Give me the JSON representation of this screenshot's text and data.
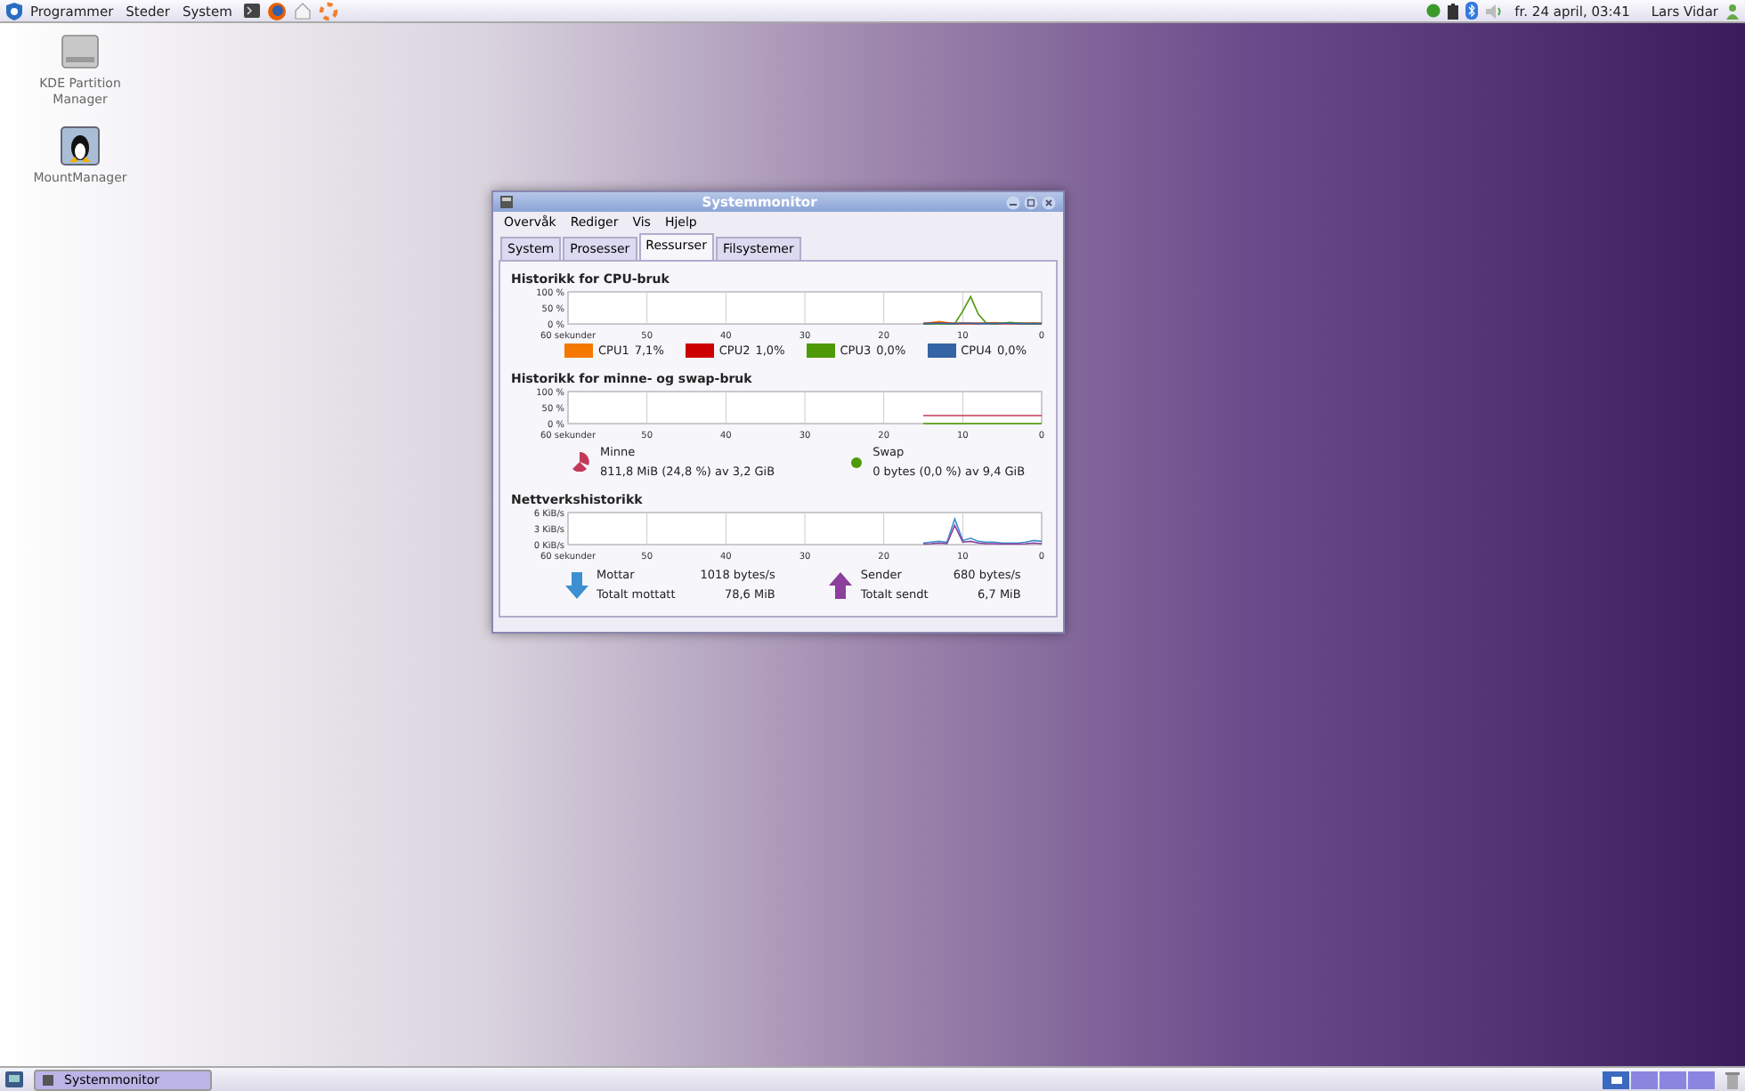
{
  "top_panel": {
    "menus": [
      "Programmer",
      "Steder",
      "System"
    ],
    "clock": "fr. 24 april, 03:41",
    "user": "Lars Vidar"
  },
  "desktop_icons": [
    {
      "kind": "disk",
      "label": "KDE Partition Manager"
    },
    {
      "kind": "penguin",
      "label": "MountManager"
    }
  ],
  "window": {
    "title": "Systemmonitor",
    "menu": [
      "Overvåk",
      "Rediger",
      "Vis",
      "Hjelp"
    ],
    "tabs": [
      {
        "label": "System",
        "selected": false
      },
      {
        "label": "Prosesser",
        "selected": false
      },
      {
        "label": "Ressurser",
        "selected": true
      },
      {
        "label": "Filsystemer",
        "selected": false
      }
    ],
    "cpu": {
      "title": "Historikk for CPU-bruk",
      "graph": {
        "kind": "cpu",
        "y_labels": [
          "100 %",
          "50 %",
          "0 %"
        ],
        "x_labels": [
          "60 sekunder",
          "50",
          "40",
          "30",
          "20",
          "10",
          "0"
        ]
      },
      "legend": [
        {
          "label": "CPU1",
          "value": "7,1%",
          "color": "#f57900"
        },
        {
          "label": "CPU2",
          "value": "1,0%",
          "color": "#cc0000"
        },
        {
          "label": "CPU3",
          "value": "0,0%",
          "color": "#4e9a06"
        },
        {
          "label": "CPU4",
          "value": "0,0%",
          "color": "#3465a4"
        }
      ]
    },
    "memory": {
      "title": "Historikk for minne- og swap-bruk",
      "graph": {
        "kind": "memory",
        "y_labels": [
          "100 %",
          "50 %",
          "0 %"
        ],
        "x_labels": [
          "60 sekunder",
          "50",
          "40",
          "30",
          "20",
          "10",
          "0"
        ]
      },
      "items": [
        {
          "kind": "pie",
          "name": "Minne",
          "detail": "811,8 MiB (24,8 %) av 3,2 GiB",
          "color": "#c4385a"
        },
        {
          "kind": "dot",
          "name": "Swap",
          "detail": "0 bytes (0,0 %) av 9,4 GiB",
          "color": "#4e9a06"
        }
      ]
    },
    "network": {
      "title": "Nettverkshistorikk",
      "graph": {
        "kind": "network",
        "y_labels": [
          "6 KiB/s",
          "3 KiB/s",
          "0 KiB/s"
        ],
        "x_labels": [
          "60 sekunder",
          "50",
          "40",
          "30",
          "20",
          "10",
          "0"
        ]
      },
      "stats": [
        {
          "kind": "down",
          "color": "#3c8fd0",
          "rate_label": "Mottar",
          "rate": "1018 bytes/s",
          "total_label": "Totalt mottatt",
          "total": "78,6 MiB"
        },
        {
          "kind": "up",
          "color": "#8d3f9c",
          "rate_label": "Sender",
          "rate": "680 bytes/s",
          "total_label": "Totalt sendt",
          "total": "6,7 MiB"
        }
      ]
    }
  },
  "taskbar": {
    "windows": [
      {
        "label": "Systemmonitor",
        "selected": true
      }
    ],
    "workspaces": [
      {
        "selected": true
      },
      {
        "selected": false
      },
      {
        "selected": false
      },
      {
        "selected": false
      }
    ]
  }
}
